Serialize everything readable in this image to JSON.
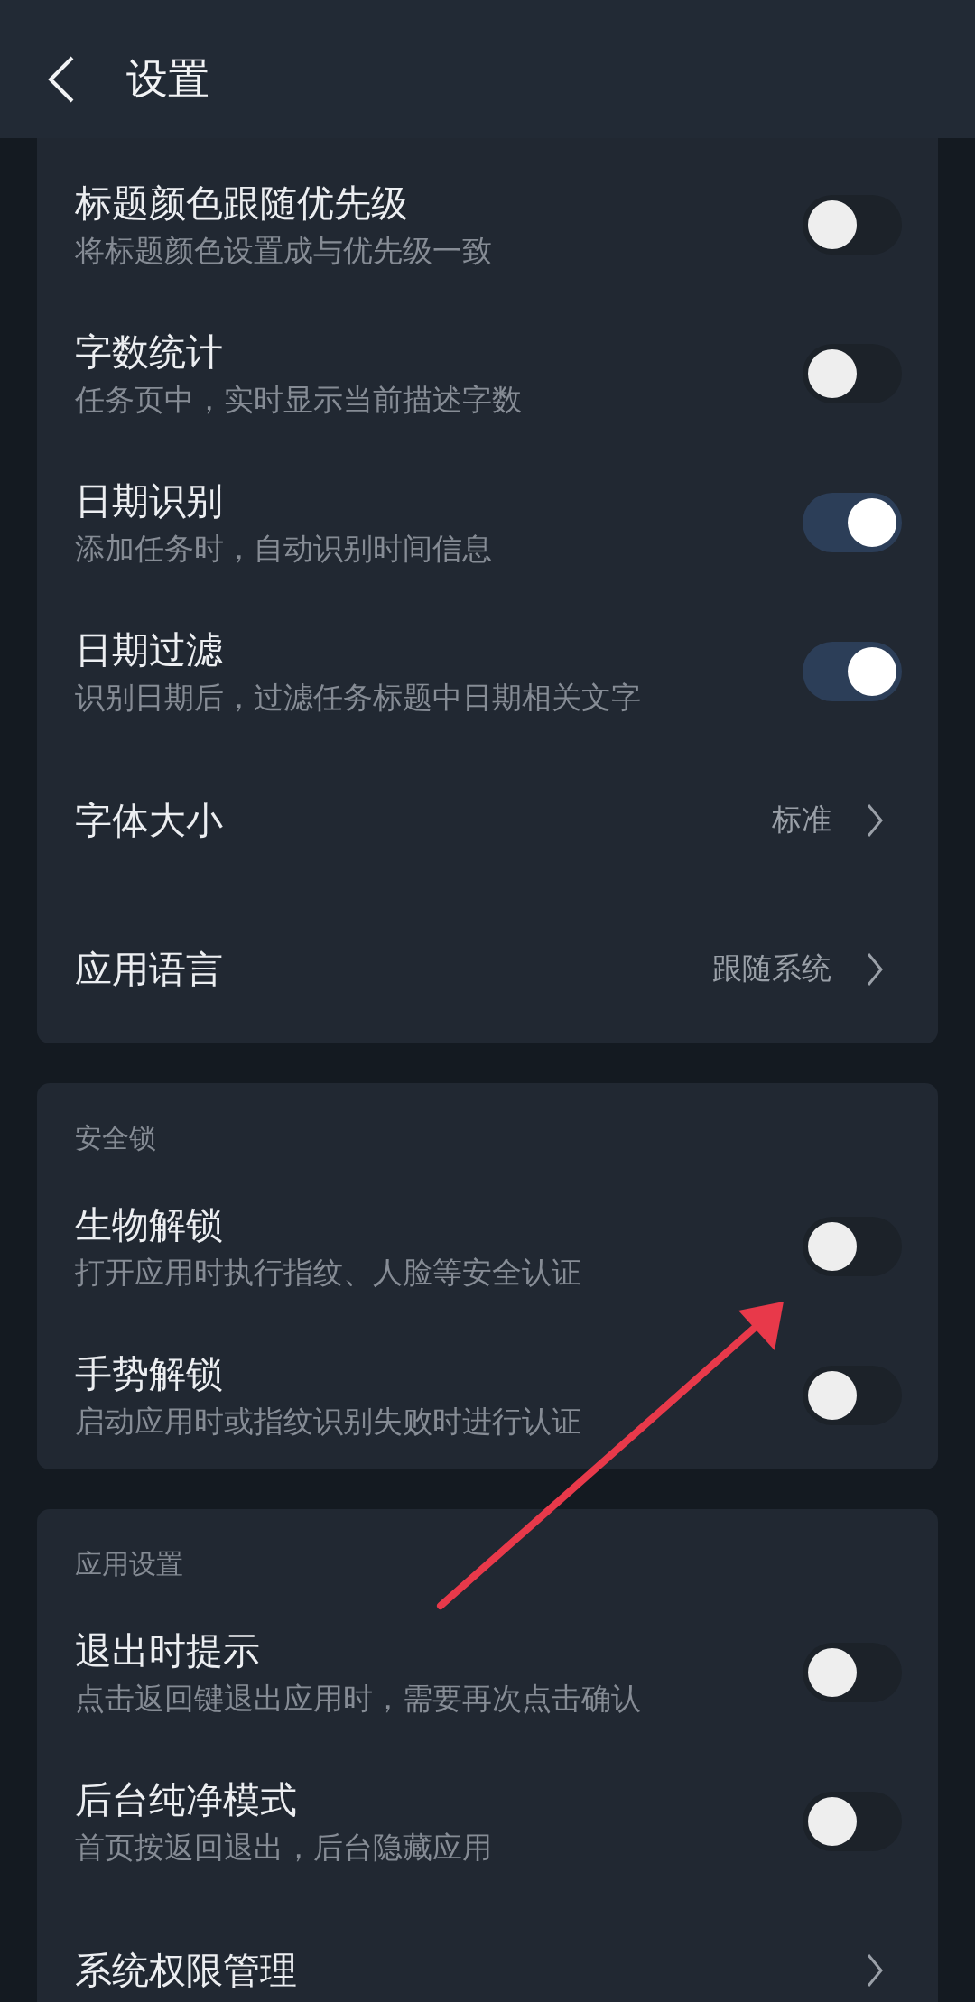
{
  "header": {
    "title": "设置"
  },
  "sections": [
    {
      "items": [
        {
          "kind": "toggle",
          "title": "标题颜色跟随优先级",
          "subtitle": "将标题颜色设置成与优先级一致",
          "on": false
        },
        {
          "kind": "toggle",
          "title": "字数统计",
          "subtitle": "任务页中，实时显示当前描述字数",
          "on": false
        },
        {
          "kind": "toggle",
          "title": "日期识别",
          "subtitle": "添加任务时，自动识别时间信息",
          "on": true
        },
        {
          "kind": "toggle",
          "title": "日期过滤",
          "subtitle": "识别日期后，过滤任务标题中日期相关文字",
          "on": true
        },
        {
          "kind": "link",
          "title": "字体大小",
          "value": "标准"
        },
        {
          "kind": "link",
          "title": "应用语言",
          "value": "跟随系统"
        }
      ]
    },
    {
      "title": "安全锁",
      "items": [
        {
          "kind": "toggle",
          "title": "生物解锁",
          "subtitle": "打开应用时执行指纹、人脸等安全认证",
          "on": false
        },
        {
          "kind": "toggle",
          "title": "手势解锁",
          "subtitle": "启动应用时或指纹识别失败时进行认证",
          "on": false
        }
      ]
    },
    {
      "title": "应用设置",
      "items": [
        {
          "kind": "toggle",
          "title": "退出时提示",
          "subtitle": "点击返回键退出应用时，需要再次点击确认",
          "on": false
        },
        {
          "kind": "toggle",
          "title": "后台纯净模式",
          "subtitle": "首页按返回退出，后台隐藏应用",
          "on": false
        },
        {
          "kind": "link",
          "title": "系统权限管理"
        }
      ]
    }
  ]
}
